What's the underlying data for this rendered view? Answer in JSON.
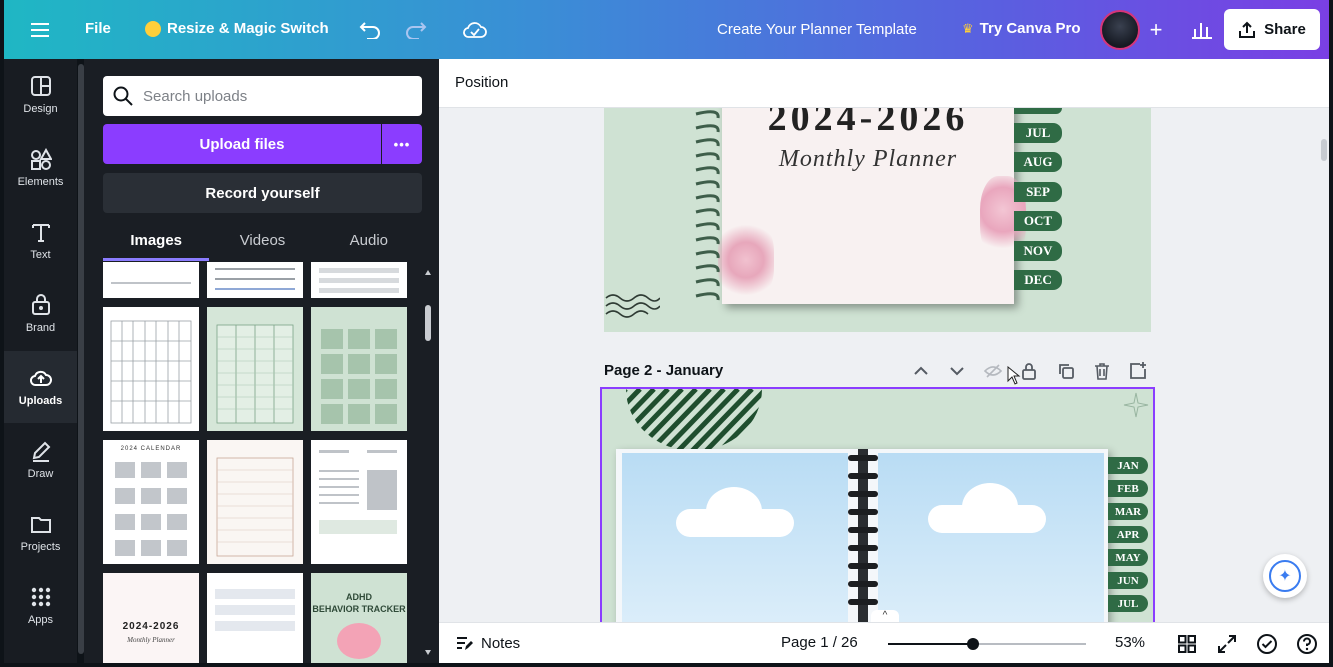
{
  "topbar": {
    "file_label": "File",
    "resize_label": "Resize & Magic Switch",
    "title": "Create Your Planner Template",
    "try_pro_label": "Try Canva Pro",
    "share_label": "Share"
  },
  "rail": {
    "items": [
      {
        "label": "Design",
        "icon": "design-icon"
      },
      {
        "label": "Elements",
        "icon": "elements-icon"
      },
      {
        "label": "Text",
        "icon": "text-icon"
      },
      {
        "label": "Brand",
        "icon": "brand-icon"
      },
      {
        "label": "Uploads",
        "icon": "uploads-icon",
        "active": true
      },
      {
        "label": "Draw",
        "icon": "draw-icon"
      },
      {
        "label": "Projects",
        "icon": "projects-icon"
      },
      {
        "label": "Apps",
        "icon": "apps-icon"
      }
    ]
  },
  "panel": {
    "search_placeholder": "Search uploads",
    "upload_label": "Upload files",
    "upload_more_label": "•••",
    "record_label": "Record yourself",
    "tabs": [
      {
        "label": "Images",
        "active": true
      },
      {
        "label": "Videos"
      },
      {
        "label": "Audio"
      }
    ],
    "thumb_texts": {
      "calendar_title": "2024 CALENDAR",
      "planner_title": "2024-2026",
      "planner_subtitle": "Monthly Planner",
      "tracker_title_1": "ADHD",
      "tracker_title_2": "BEHAVIOR TRACKER"
    }
  },
  "canvas": {
    "context_label": "Position",
    "page1": {
      "title_partial": "2024-2026",
      "subtitle": "Monthly Planner",
      "months": [
        "JUL",
        "AUG",
        "SEP",
        "OCT",
        "NOV",
        "DEC"
      ]
    },
    "page2": {
      "label": "Page 2 - January",
      "months": [
        "JAN",
        "FEB",
        "MAR",
        "APR",
        "MAY",
        "JUN",
        "JUL"
      ]
    }
  },
  "bottombar": {
    "notes_label": "Notes",
    "page_indicator": "Page 1 / 26",
    "zoom_label": "53%",
    "zoom_fraction": 0.43
  },
  "colors": {
    "accent": "#8b3dff",
    "sage": "#cfe2d3",
    "tab_green": "#2f6b45"
  }
}
